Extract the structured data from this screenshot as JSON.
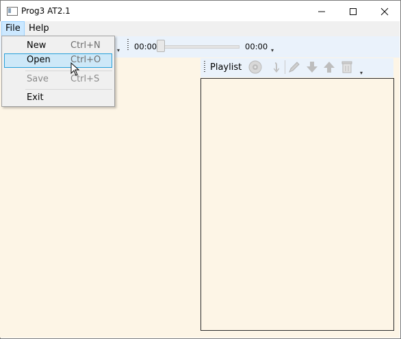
{
  "window": {
    "title": "Prog3 AT2.1"
  },
  "window_controls": {
    "minimize": "—",
    "maximize": "☐",
    "close": "✕"
  },
  "menubar": {
    "file": "File",
    "help": "Help"
  },
  "file_menu": {
    "items": [
      {
        "label": "New",
        "shortcut": "Ctrl+N"
      },
      {
        "label": "Open",
        "shortcut": "Ctrl+O"
      },
      {
        "label": "Save",
        "shortcut": "Ctrl+S"
      },
      {
        "label": "Exit",
        "shortcut": ""
      }
    ]
  },
  "player": {
    "current_time": "00:00",
    "total_time": "00:00",
    "position": 0
  },
  "playlist_toolbar": {
    "label": "Playlist",
    "icons": [
      "disc-icon",
      "import-arrow-icon",
      "pencil-icon",
      "arrow-down-icon",
      "arrow-up-icon",
      "trash-icon"
    ]
  },
  "colors": {
    "content_bg": "#fdf5e6",
    "toolbar_bg": "#eaf2fb",
    "menu_highlight": "#cde8f8"
  }
}
